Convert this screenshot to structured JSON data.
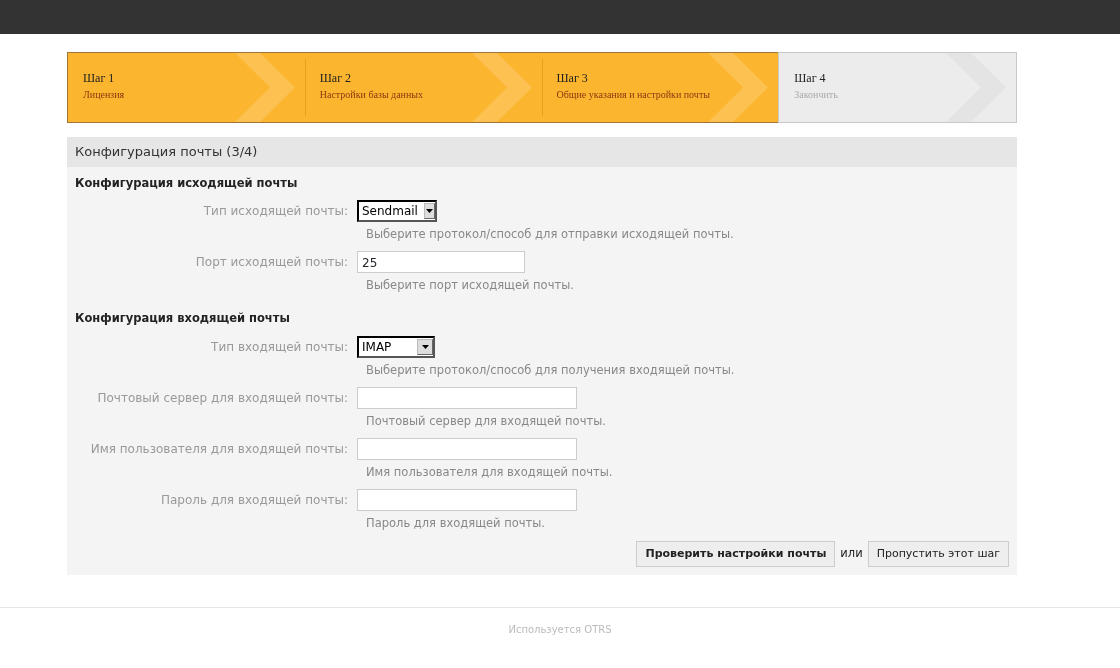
{
  "steps": [
    {
      "title": "Шаг 1",
      "subtitle": "Лицензия",
      "done": true
    },
    {
      "title": "Шаг 2",
      "subtitle": "Настройки базы данных",
      "done": true
    },
    {
      "title": "Шаг 3",
      "subtitle": "Общие указания и настройки почты",
      "done": true
    },
    {
      "title": "Шаг 4",
      "subtitle": "Закончить",
      "done": false
    }
  ],
  "panel": {
    "title": "Конфигурация почты (3/4)",
    "sections": [
      {
        "heading": "Конфигурация исходящей почты",
        "fields": [
          {
            "kind": "select",
            "label": "Тип исходящей почты:",
            "value": "Sendmail",
            "hint": "Выберите протокол/способ для отправки исходящей почты."
          },
          {
            "kind": "text",
            "label": "Порт исходящей почты:",
            "value": "25",
            "hint": "Выберите порт исходящей почты."
          }
        ]
      },
      {
        "heading": "Конфигурация входящей почты",
        "fields": [
          {
            "kind": "select",
            "label": "Тип входящей почты:",
            "value": "IMAP",
            "hint": "Выберите протокол/способ для получения входящей почты."
          },
          {
            "kind": "text",
            "label": "Почтовый сервер для входящей почты:",
            "hint": "Почтовый сервер для входящей почты."
          },
          {
            "kind": "text",
            "label": "Имя пользователя для входящей почты:",
            "hint": "Имя пользователя для входящей почты."
          },
          {
            "kind": "text",
            "label": "Пароль для входящей почты:",
            "hint": "Пароль для входящей почты."
          }
        ]
      }
    ],
    "primary_button": "Проверить настройки почты",
    "separator": "или",
    "secondary_button": "Пропустить этот шаг"
  },
  "footer": "Используется OTRS"
}
